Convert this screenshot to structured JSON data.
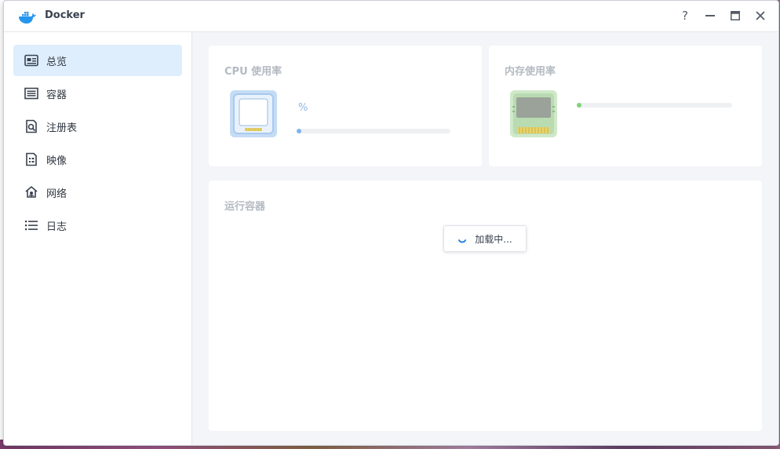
{
  "window": {
    "title": "Docker"
  },
  "titlebar": {
    "help": "?",
    "minimize": "—",
    "maximize": "▭",
    "close": "✕"
  },
  "sidebar": {
    "items": [
      {
        "label": "总览",
        "icon": "overview-icon",
        "active": true
      },
      {
        "label": "容器",
        "icon": "container-icon",
        "active": false
      },
      {
        "label": "注册表",
        "icon": "registry-icon",
        "active": false
      },
      {
        "label": "映像",
        "icon": "image-icon",
        "active": false
      },
      {
        "label": "网络",
        "icon": "network-icon",
        "active": false
      },
      {
        "label": "日志",
        "icon": "log-icon",
        "active": false
      }
    ]
  },
  "main": {
    "cpu": {
      "title": "CPU 使用率",
      "value_text": "%",
      "usage_fraction": 0.02,
      "color": "#7fb3f0"
    },
    "memory": {
      "title": "内存使用率",
      "usage_fraction": 0.02,
      "color": "#7fd37a"
    },
    "running": {
      "title": "运行容器",
      "loading_text": "加载中..."
    }
  },
  "colors": {
    "accent": "#dfeefc",
    "text": "#2f3640",
    "muted": "#b4bac2"
  }
}
